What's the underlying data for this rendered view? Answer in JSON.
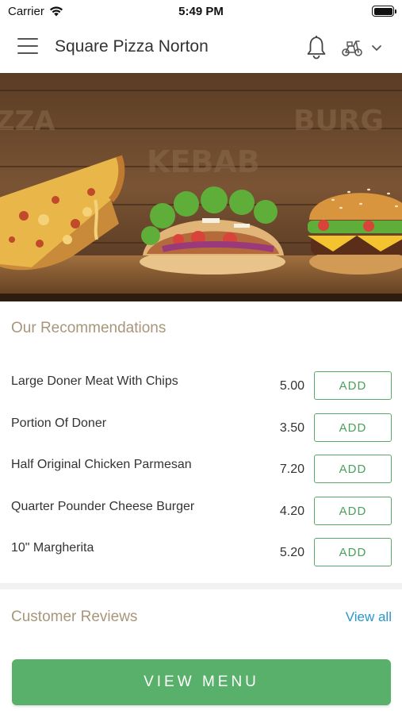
{
  "status_bar": {
    "carrier": "Carrier",
    "time": "5:49 PM"
  },
  "header": {
    "title": "Square Pizza Norton",
    "menu_icon": "hamburger-menu-icon",
    "bell_icon": "bell-icon",
    "delivery_icon": "scooter-icon",
    "dropdown_icon": "chevron-down-icon"
  },
  "hero": {
    "image_desc_icons": [
      "pizza",
      "kebab",
      "burger"
    ],
    "wall_text": [
      "ZZA",
      "KEBAB",
      "BURG"
    ]
  },
  "recommendations": {
    "title": "Our Recommendations",
    "items": [
      {
        "name": "Large Doner Meat With Chips",
        "price": "5.00",
        "button": "ADD"
      },
      {
        "name": "Portion Of Doner",
        "price": "3.50",
        "button": "ADD"
      },
      {
        "name": "Half Original Chicken Parmesan",
        "price": "7.20",
        "button": "ADD"
      },
      {
        "name": "Quarter Pounder Cheese Burger",
        "price": "4.20",
        "button": "ADD"
      },
      {
        "name": "10\" Margherita",
        "price": "5.20",
        "button": "ADD"
      }
    ]
  },
  "reviews": {
    "title": "Customer Reviews",
    "view_all": "View all"
  },
  "footer": {
    "view_menu": "VIEW MENU"
  },
  "colors": {
    "accent_green": "#59b06a",
    "section_title": "#a8967a",
    "link_blue": "#2a97c9"
  }
}
